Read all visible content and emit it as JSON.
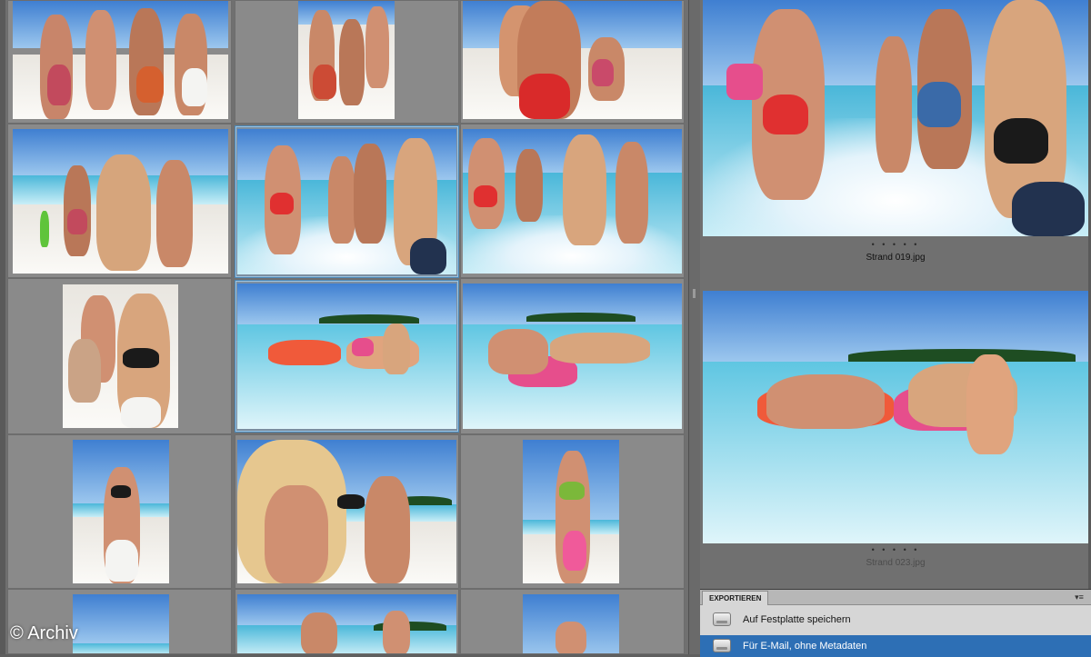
{
  "watermark": "© Archiv",
  "thumbnails": {
    "rows": 5,
    "columns": 3,
    "selected": [
      "row2-col2",
      "row3-col2"
    ]
  },
  "preview": {
    "items": [
      {
        "dots": "• • • • •",
        "filename": "Strand 019.jpg"
      },
      {
        "dots": "• • • • •",
        "filename": "Strand 023.jpg"
      }
    ]
  },
  "export_panel": {
    "tab_label": "EXPORTIEREN",
    "menu_icon": "panel-menu-icon",
    "items": [
      {
        "label": "Auf Festplatte speichern",
        "icon": "hard-disk-icon",
        "selected": false
      },
      {
        "label": "Für E-Mail, ohne Metadaten",
        "icon": "hard-disk-icon",
        "selected": true
      }
    ]
  },
  "colors": {
    "background": "#707070",
    "selection": "#2d6fb5",
    "panel": "#d6d6d6"
  }
}
